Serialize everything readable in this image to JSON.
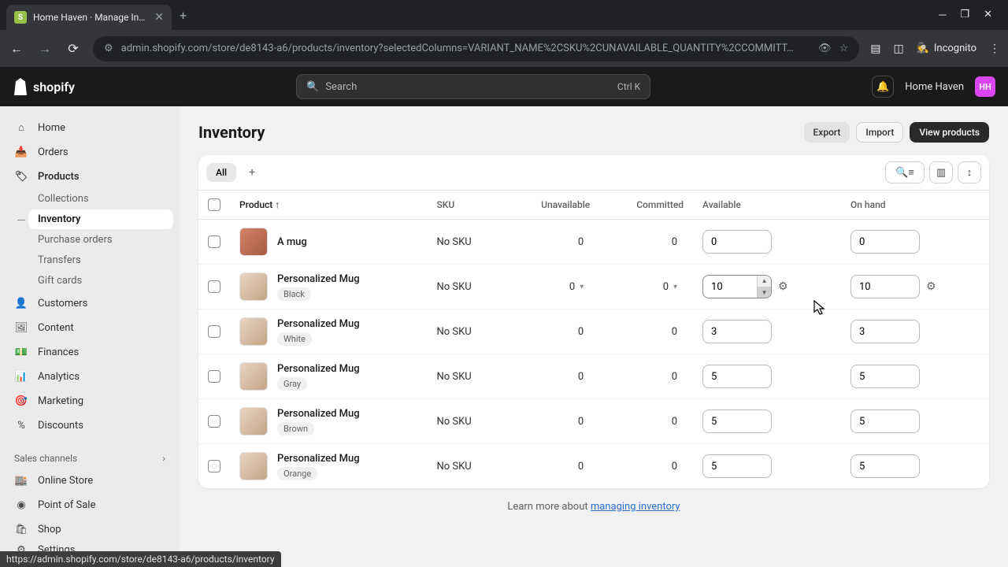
{
  "browser": {
    "tab_title": "Home Haven · Manage Invento",
    "url": "admin.shopify.com/store/de8143-a6/products/inventory?selectedColumns=VARIANT_NAME%2CSKU%2CUNAVAILABLE_QUANTITY%2CCOMMITT…",
    "incognito": "Incognito"
  },
  "header": {
    "logo": "shopify",
    "search_placeholder": "Search",
    "search_kbd": "Ctrl K",
    "store_name": "Home Haven",
    "store_initials": "HH"
  },
  "sidebar": {
    "items": [
      {
        "label": "Home",
        "icon": "home"
      },
      {
        "label": "Orders",
        "icon": "orders"
      },
      {
        "label": "Products",
        "icon": "tag",
        "bold": true
      },
      {
        "label": "Customers",
        "icon": "user"
      },
      {
        "label": "Content",
        "icon": "image"
      },
      {
        "label": "Finances",
        "icon": "money"
      },
      {
        "label": "Analytics",
        "icon": "chart"
      },
      {
        "label": "Marketing",
        "icon": "target"
      },
      {
        "label": "Discounts",
        "icon": "percent"
      }
    ],
    "products_sub": [
      {
        "label": "Collections"
      },
      {
        "label": "Inventory",
        "active": true
      },
      {
        "label": "Purchase orders"
      },
      {
        "label": "Transfers"
      },
      {
        "label": "Gift cards"
      }
    ],
    "sales_channels_label": "Sales channels",
    "sales_channels": [
      {
        "label": "Online Store",
        "icon": "store"
      },
      {
        "label": "Point of Sale",
        "icon": "pos"
      },
      {
        "label": "Shop",
        "icon": "shop"
      }
    ],
    "settings": "Settings"
  },
  "page": {
    "title": "Inventory",
    "export": "Export",
    "import": "Import",
    "view_products": "View products",
    "tab_all": "All"
  },
  "table": {
    "headers": {
      "product": "Product",
      "sku": "SKU",
      "unavailable": "Unavailable",
      "committed": "Committed",
      "available": "Available",
      "on_hand": "On hand"
    },
    "rows": [
      {
        "name": "A mug",
        "variant": "",
        "sku": "No SKU",
        "unavailable": "0",
        "committed": "0",
        "available": "0",
        "on_hand": "0",
        "img": "red"
      },
      {
        "name": "Personalized Mug",
        "variant": "Black",
        "sku": "No SKU",
        "unavailable": "0",
        "committed": "0",
        "available": "10",
        "on_hand": "10",
        "hover": true
      },
      {
        "name": "Personalized Mug",
        "variant": "White",
        "sku": "No SKU",
        "unavailable": "0",
        "committed": "0",
        "available": "3",
        "on_hand": "3"
      },
      {
        "name": "Personalized Mug",
        "variant": "Gray",
        "sku": "No SKU",
        "unavailable": "0",
        "committed": "0",
        "available": "5",
        "on_hand": "5"
      },
      {
        "name": "Personalized Mug",
        "variant": "Brown",
        "sku": "No SKU",
        "unavailable": "0",
        "committed": "0",
        "available": "5",
        "on_hand": "5"
      },
      {
        "name": "Personalized Mug",
        "variant": "Orange",
        "sku": "No SKU",
        "unavailable": "0",
        "committed": "0",
        "available": "5",
        "on_hand": "5"
      }
    ]
  },
  "footer": {
    "prefix": "Learn more about ",
    "link": "managing inventory"
  },
  "status_url": "https://admin.shopify.com/store/de8143-a6/products/inventory"
}
